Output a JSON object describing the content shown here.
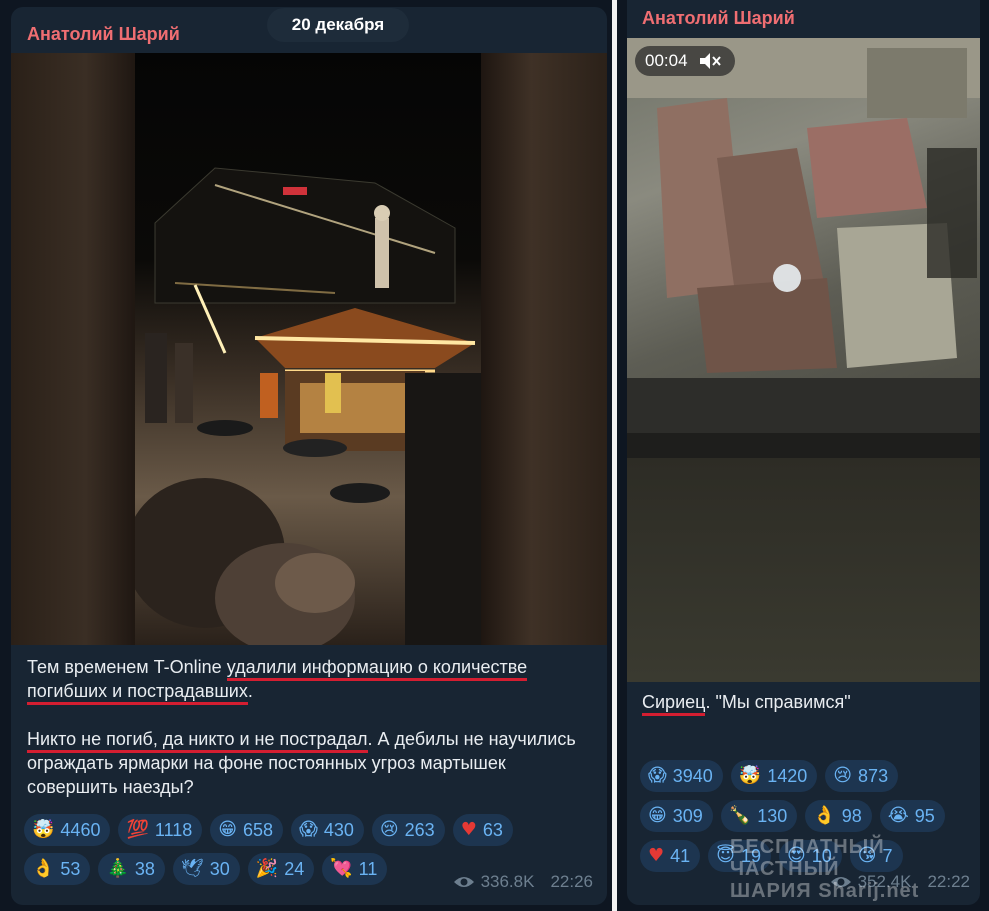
{
  "date_pill": "20 декабря",
  "left_post": {
    "author": "Анатолий Шарий",
    "paragraph1_underlined_a": "удалили информацию о количестве",
    "paragraph1_prefix": "Тем временем T-Online ",
    "paragraph1_underlined_b": "погибших и пострадавших",
    "paragraph1_suffix": ".",
    "paragraph2_underlined": "Никто не погиб, да никто и не пострадал",
    "paragraph2_rest": ". А дебилы не научились ограждать ярмарки на фоне постоянных угроз мартышек совершить наезды?",
    "reactions": [
      {
        "emoji": "🤯",
        "count": "4460"
      },
      {
        "emoji": "💯",
        "count": "1118"
      },
      {
        "emoji": "😁",
        "count": "658"
      },
      {
        "emoji": "😱",
        "count": "430"
      },
      {
        "emoji": "😢",
        "count": "263"
      },
      {
        "emoji": "♥",
        "count": "63"
      },
      {
        "emoji": "👌",
        "count": "53"
      },
      {
        "emoji": "🎄",
        "count": "38"
      },
      {
        "emoji": "🕊",
        "count": "30"
      },
      {
        "emoji": "🎉",
        "count": "24"
      },
      {
        "emoji": "💘",
        "count": "11"
      }
    ],
    "views": "336.8K",
    "time": "22:26"
  },
  "right_post": {
    "author": "Анатолий Шарий",
    "video_time": "00:04",
    "caption_underlined": "Сириец",
    "caption_rest": ". \"Мы справимся\"",
    "reactions": [
      {
        "emoji": "😱",
        "count": "3940"
      },
      {
        "emoji": "🤯",
        "count": "1420"
      },
      {
        "emoji": "😢",
        "count": "873"
      },
      {
        "emoji": "😁",
        "count": "309"
      },
      {
        "emoji": "🍾",
        "count": "130"
      },
      {
        "emoji": "👌",
        "count": "98"
      },
      {
        "emoji": "😭",
        "count": "95"
      },
      {
        "emoji": "♥",
        "count": "41"
      },
      {
        "emoji": "😇",
        "count": "19"
      },
      {
        "emoji": "😍",
        "count": "10"
      },
      {
        "emoji": "😘",
        "count": "7"
      }
    ],
    "views": "352.4K",
    "time": "22:22"
  },
  "watermark": {
    "line1": "БЕСПЛАТНЫЙ ЧАСТНЫЙ",
    "line2": "ШАРИЯ Sharij.net"
  },
  "colors": {
    "background": "#0e1621",
    "bubble": "#182533",
    "author": "#ef6e72",
    "reaction_bg": "#1d3550",
    "reaction_text": "#6ab3f3",
    "underline": "#d41e31",
    "meta": "#6d7f8f"
  },
  "icons": {
    "views": "eye-icon",
    "sound": "speaker-muted-icon"
  }
}
